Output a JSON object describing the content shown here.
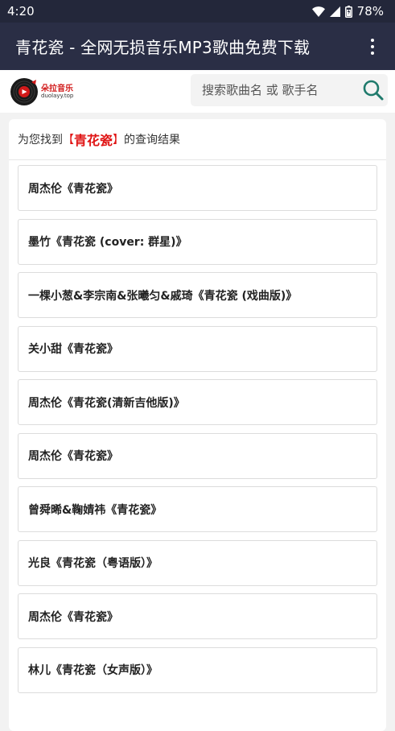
{
  "status_bar": {
    "time": "4:20",
    "battery": "78%"
  },
  "app_bar": {
    "title": "青花瓷 - 全网无损音乐MP3歌曲免费下载",
    "menu_icon": "more-vertical-icon"
  },
  "header": {
    "logo_name": "朵拉音乐",
    "logo_domain": "duolayy.top",
    "search_placeholder": "搜索歌曲名 或 歌手名",
    "search_icon": "search-icon"
  },
  "results": {
    "prefix": "为您找到",
    "open_bracket": "【",
    "query": "青花瓷",
    "close_bracket": "】",
    "suffix": "的查询结果",
    "items": [
      {
        "label": "周杰伦《青花瓷》"
      },
      {
        "label": "墨竹《青花瓷 (cover: 群星)》"
      },
      {
        "label": "一棵小葱&李宗南&张曦匀&戚琦《青花瓷 (戏曲版)》"
      },
      {
        "label": "关小甜《青花瓷》"
      },
      {
        "label": "周杰伦《青花瓷(清新吉他版)》"
      },
      {
        "label": "周杰伦《青花瓷》"
      },
      {
        "label": "曾舜晞&鞠婧祎《青花瓷》"
      },
      {
        "label": "光良《青花瓷（粤语版）》"
      },
      {
        "label": "周杰伦《青花瓷》"
      },
      {
        "label": "林儿《青花瓷（女声版）》"
      }
    ]
  },
  "colors": {
    "app_bar": "#2a2e45",
    "status_bar": "#23273a",
    "accent_red": "#e01414",
    "search_icon": "#1f7a6c"
  }
}
